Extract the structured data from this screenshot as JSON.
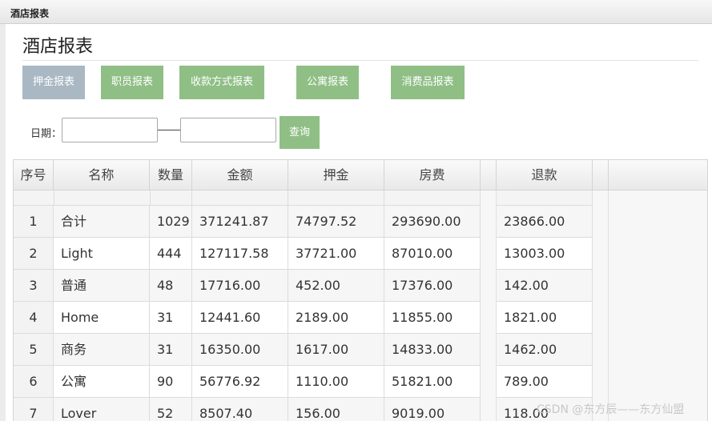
{
  "window": {
    "title": "酒店报表"
  },
  "page": {
    "heading": "酒店报表"
  },
  "tabs": [
    {
      "label": "押金报表",
      "active": true
    },
    {
      "label": "职员报表",
      "active": false
    },
    {
      "label": "收款方式报表",
      "active": false
    },
    {
      "label": "公寓报表",
      "active": false
    },
    {
      "label": "消费品报表",
      "active": false
    }
  ],
  "filter": {
    "date_label": "日期：",
    "start_value": "",
    "end_value": "",
    "query_label": "查询"
  },
  "table": {
    "columns": [
      "序号",
      "名称",
      "数量",
      "金额",
      "押金",
      "房费",
      "",
      "退款",
      ""
    ],
    "rows": [
      [
        "1",
        "合计",
        "1029",
        "371241.87",
        "74797.52",
        "293690.00",
        "23866.00"
      ],
      [
        "2",
        "Light",
        "444",
        "127117.58",
        "37721.00",
        "87010.00",
        "13003.00"
      ],
      [
        "3",
        "普通",
        "48",
        "17716.00",
        "452.00",
        "17376.00",
        "142.00"
      ],
      [
        "4",
        "Home",
        "31",
        "12441.60",
        "2189.00",
        "11855.00",
        "1821.00"
      ],
      [
        "5",
        "商务",
        "31",
        "16350.00",
        "1617.00",
        "14833.00",
        "1462.00"
      ],
      [
        "6",
        "公寓",
        "90",
        "56776.92",
        "1110.00",
        "51821.00",
        "789.00"
      ],
      [
        "7",
        "Lover",
        "52",
        "8507.40",
        "156.00",
        "9019.00",
        "118.00"
      ]
    ]
  },
  "colors": {
    "tab_green": "#8fbf85",
    "tab_active": "#a9b8c3"
  },
  "watermark": "CSDN @东方辰——东方仙盟"
}
